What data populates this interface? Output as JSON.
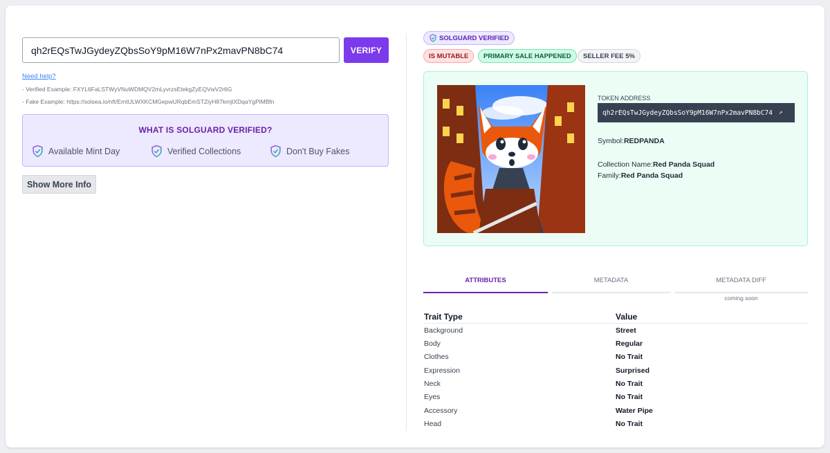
{
  "search": {
    "value": "qh2rEQsTwJGydeyZQbsSoY9pM16W7nPx2mavPN8bC74",
    "verify_label": "VERIFY"
  },
  "help": {
    "link": "Need help?",
    "verified_example": "- Verified Example: FXYL6FaLSTWyVNuWDMQV2mLyvrzsEtekgZyEQVwV2r6G",
    "fake_example": "- Fake Example: https://solsea.io/nft/EmtULWXKCMGepwURqbEmSTZiyH87kmjtXDqaYgPiMBfn"
  },
  "info": {
    "title": "WHAT IS SOLGUARD VERIFIED?",
    "items": [
      {
        "label": "Available Mint Day",
        "icon": "shield-check-icon"
      },
      {
        "label": "Verified Collections",
        "icon": "shield-check-icon"
      },
      {
        "label": "Don't Buy Fakes",
        "icon": "shield-check-icon"
      }
    ],
    "show_more": "Show More Info"
  },
  "badges": {
    "verified": "SOLGUARD VERIFIED",
    "mutable": "IS MUTABLE",
    "primary_sale": "PRIMARY SALE HAPPENED",
    "seller_fee": "SELLER FEE 5%"
  },
  "token": {
    "address_label": "TOKEN ADDRESS",
    "address": "qh2rEQsTwJGydeyZQbsSoY9pM16W7nPx2mavPN8bC74",
    "symbol_label": "Symbol:",
    "symbol": "REDPANDA",
    "collection_label": "Collection Name:",
    "collection": "Red Panda Squad",
    "family_label": "Family:",
    "family": "Red Panda Squad"
  },
  "tabs": {
    "attributes": "ATTRIBUTES",
    "metadata": "METADATA",
    "metadata_diff": "METADATA DIFF",
    "coming_soon": "coming soon"
  },
  "table": {
    "header_type": "Trait Type",
    "header_value": "Value",
    "rows": [
      {
        "type": "Background",
        "value": "Street"
      },
      {
        "type": "Body",
        "value": "Regular"
      },
      {
        "type": "Clothes",
        "value": "No Trait"
      },
      {
        "type": "Expression",
        "value": "Surprised"
      },
      {
        "type": "Neck",
        "value": "No Trait"
      },
      {
        "type": "Eyes",
        "value": "No Trait"
      },
      {
        "type": "Accessory",
        "value": "Water Pipe"
      },
      {
        "type": "Head",
        "value": "No Trait"
      }
    ]
  },
  "colors": {
    "accent": "#7c3aed",
    "verified_bg": "#ede9fe",
    "token_bg": "#ecfdf5"
  }
}
